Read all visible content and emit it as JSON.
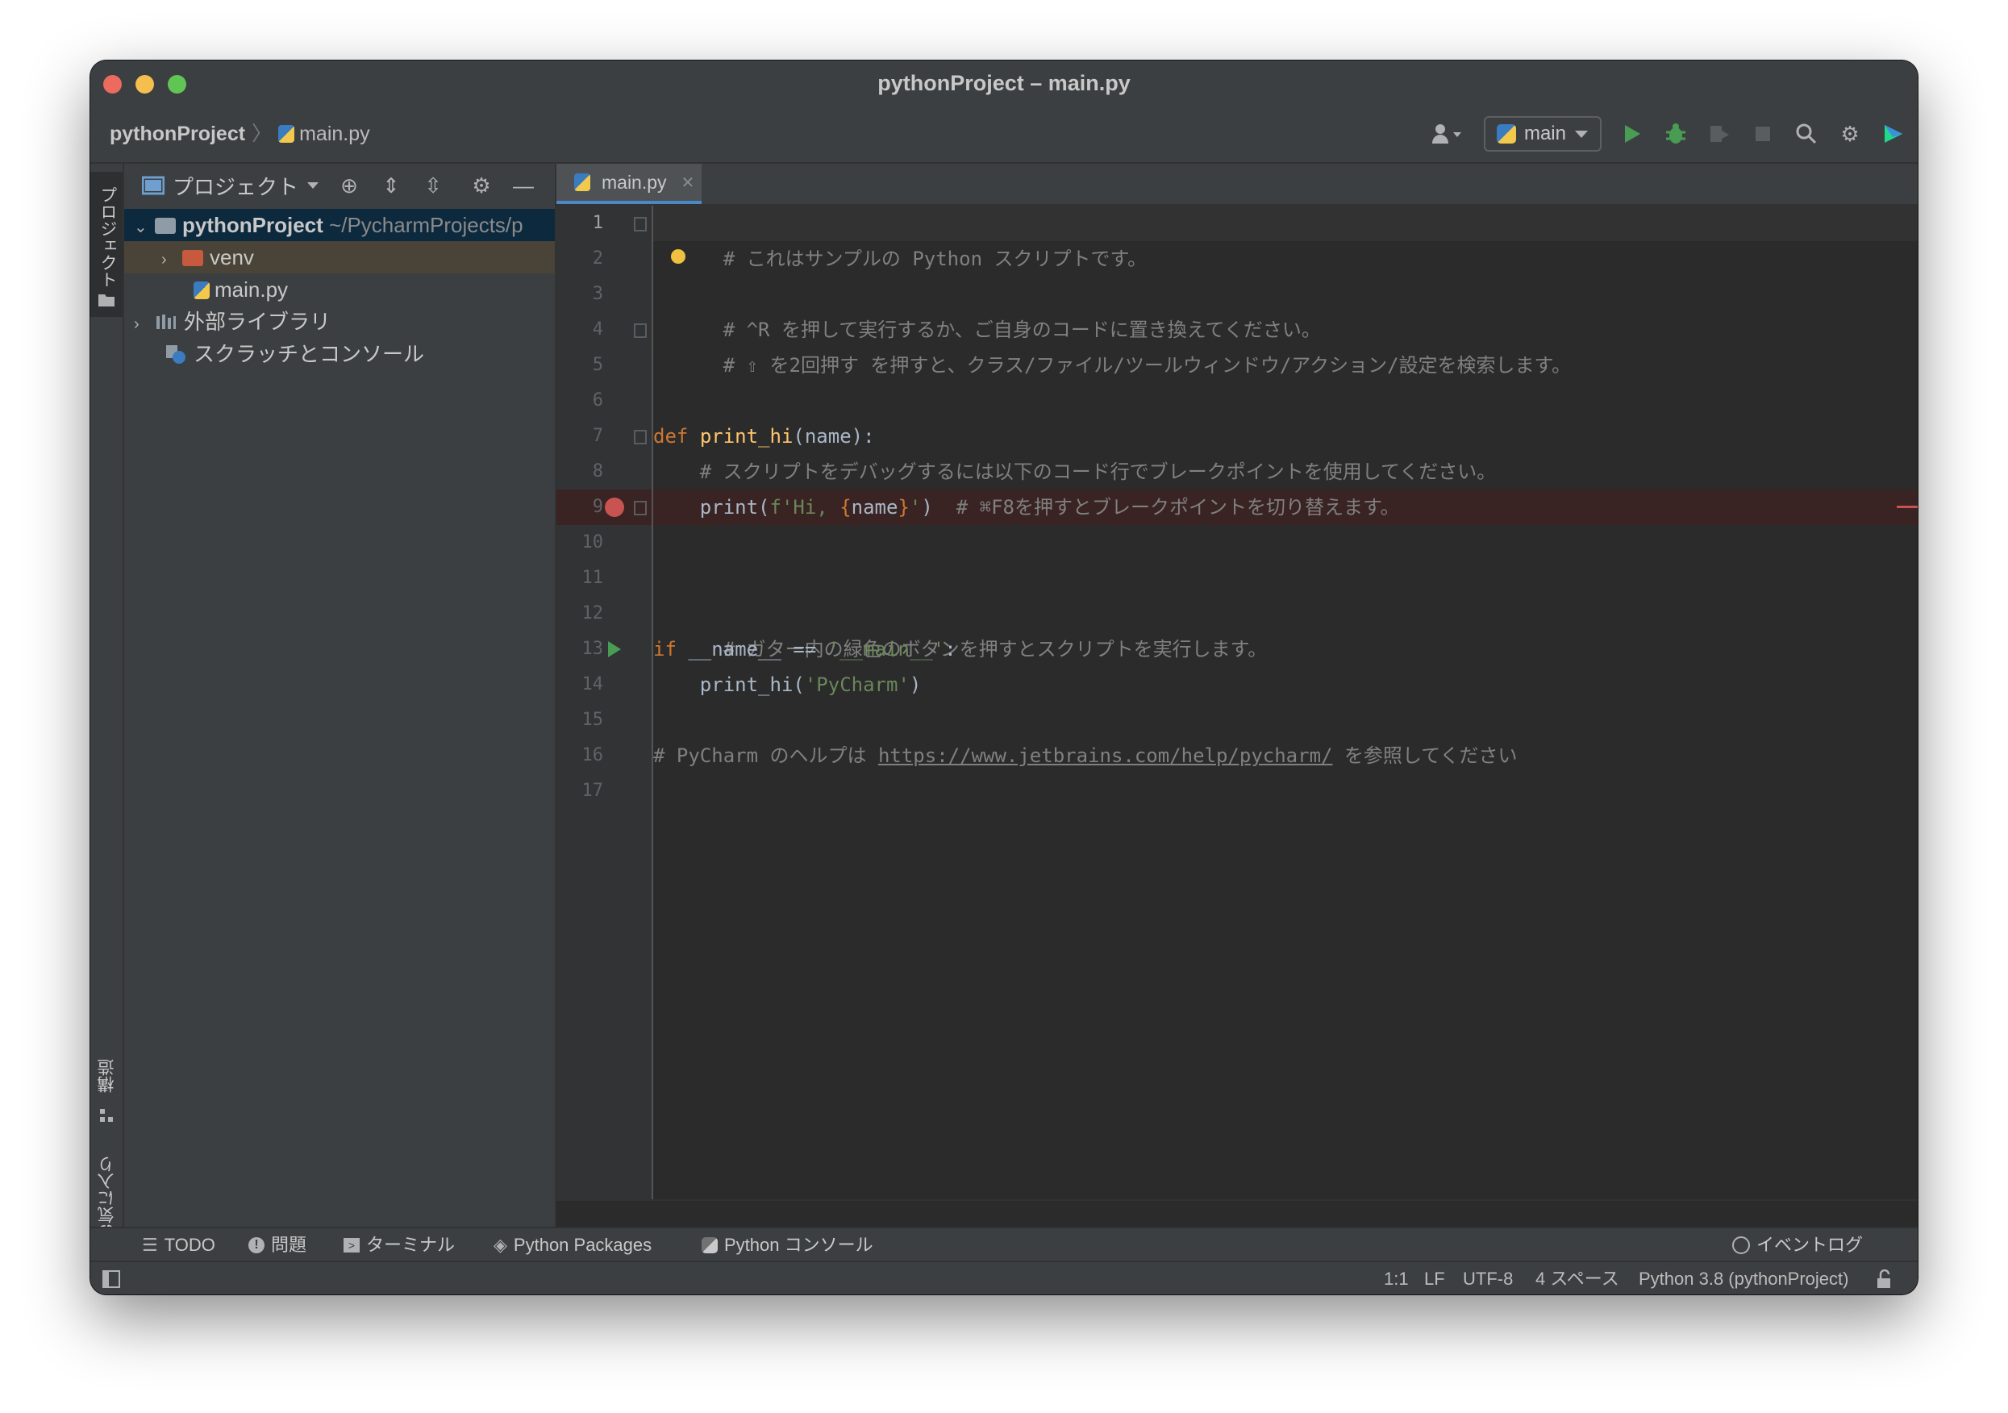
{
  "window": {
    "title": "pythonProject – main.py"
  },
  "breadcrumb": {
    "project": "pythonProject",
    "file": "main.py"
  },
  "toolbar": {
    "run_config": "main"
  },
  "sidebar": {
    "project_tab": "プロジェクト",
    "structure_tab": "構造",
    "favorites_tab": "お気に入り"
  },
  "project_panel": {
    "title": "プロジェクト",
    "tree": [
      {
        "label": "pythonProject",
        "path": "~/PycharmProjects/p"
      },
      {
        "label": "venv"
      },
      {
        "label": "main.py"
      },
      {
        "label": "外部ライブラリ"
      },
      {
        "label": "スクラッチとコンソール"
      }
    ]
  },
  "editor": {
    "tab": "main.py",
    "line_numbers": [
      "1",
      "2",
      "3",
      "4",
      "5",
      "6",
      "7",
      "8",
      "9",
      "10",
      "11",
      "12",
      "13",
      "14",
      "15",
      "16",
      "17"
    ],
    "lines": {
      "l1": "# これはサンプルの Python スクリプトです。",
      "l3": "# ^R を押して実行するか、ご自身のコードに置き換えてください。",
      "l4": "# ⇧ を2回押す を押すと、クラス/ファイル/ツールウィンドウ/アクション/設定を検索します。",
      "l7_kw": "def",
      "l7_fn": "print_hi",
      "l7_rest": "(name):",
      "l8": "# スクリプトをデバッグするには以下のコード行でブレークポイントを使用してください。",
      "l9_code": "print(",
      "l9_str1": "f'Hi, ",
      "l9_brace_open": "{",
      "l9_name": "name",
      "l9_brace_close": "}",
      "l9_str2": "'",
      "l9_close": ")",
      "l9_comment": "# ⌘F8を押すとブレークポイントを切り替えます。",
      "l12": "# ガター内の緑色のボタンを押すとスクリプトを実行します。",
      "l13_kw": "if",
      "l13_a": " __name__ == ",
      "l13_str": "'__main__'",
      "l13_b": ":",
      "l14_a": "print_hi(",
      "l14_str": "'PyCharm'",
      "l14_b": ")",
      "l16_a": "# PyCharm のヘルプは ",
      "l16_link": "https://www.jetbrains.com/help/pycharm/",
      "l16_b": " を参照してください"
    }
  },
  "tool_windows": {
    "todo": "TODO",
    "problems": "問題",
    "terminal": "ターミナル",
    "packages": "Python Packages",
    "console": "Python コンソール",
    "event_log": "イベントログ"
  },
  "status": {
    "position": "1:1",
    "line_sep": "LF",
    "encoding": "UTF-8",
    "indent": "4 スペース",
    "interpreter": "Python 3.8 (pythonProject)"
  },
  "colors": {
    "accent": "#4a88c7",
    "breakpoint": "#c75450",
    "run_green": "#499c54"
  }
}
